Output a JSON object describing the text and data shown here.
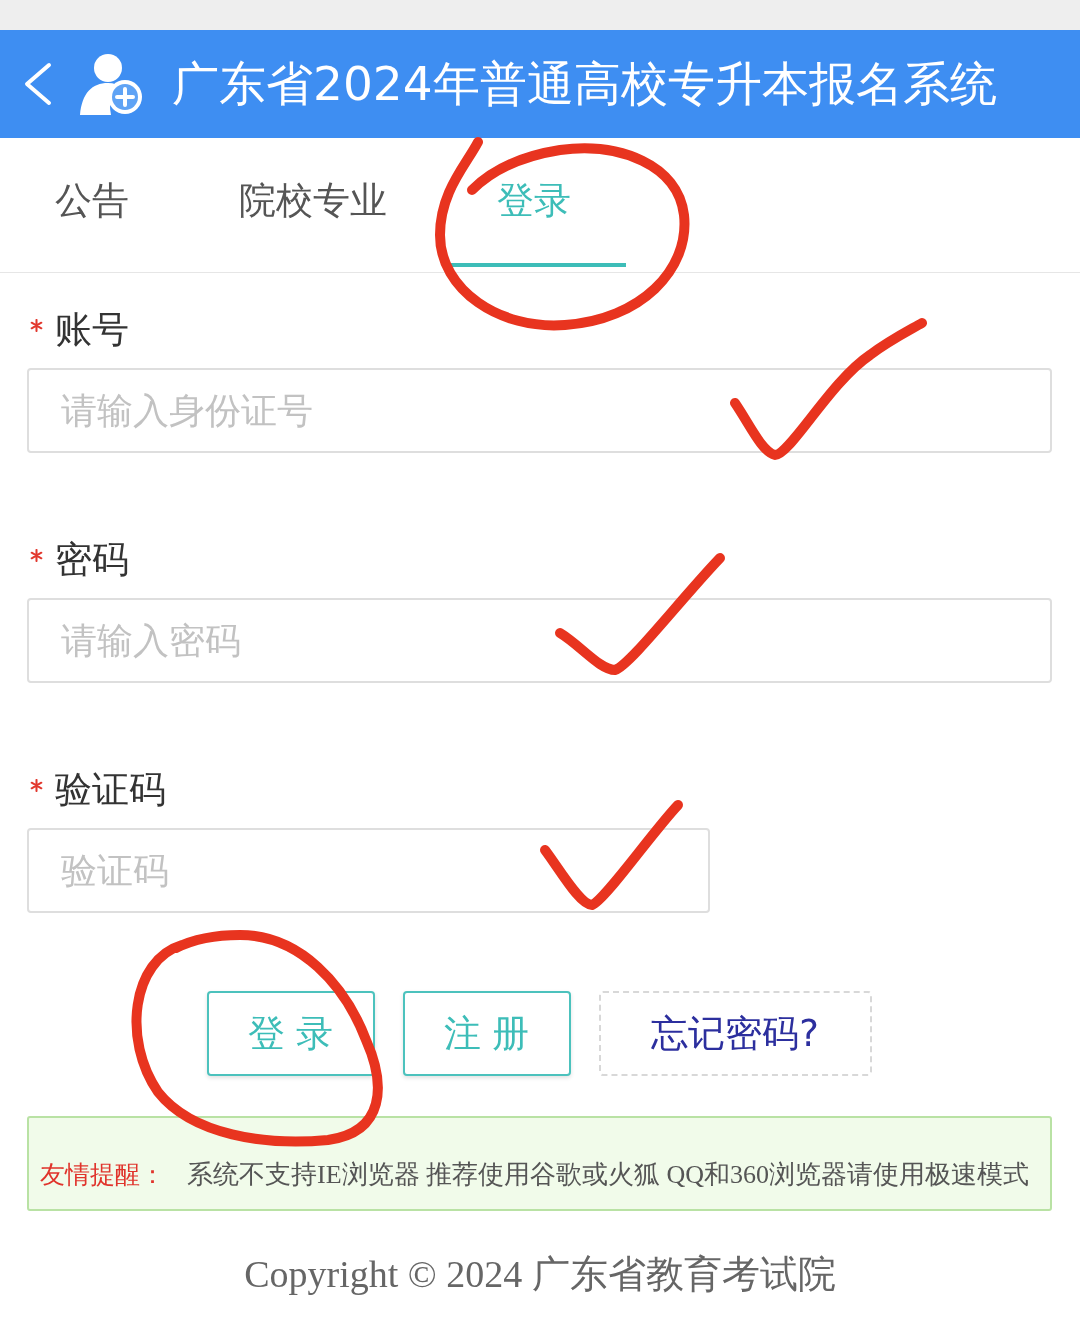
{
  "header": {
    "title": "广东省2024年普通高校专升本报名系统"
  },
  "tabs": [
    {
      "label": "公告",
      "selected": false
    },
    {
      "label": "院校专业",
      "selected": false
    },
    {
      "label": "登录",
      "selected": true
    }
  ],
  "form": {
    "fields": [
      {
        "kind": "text",
        "label": "账号",
        "required": true,
        "placeholder": "请输入身份证号"
      },
      {
        "kind": "password",
        "label": "密码",
        "required": true,
        "placeholder": "请输入密码"
      },
      {
        "kind": "captcha",
        "label": "验证码",
        "required": true,
        "placeholder": "验证码"
      }
    ],
    "buttons": [
      {
        "kind": "button",
        "label": "登 录"
      },
      {
        "kind": "button",
        "label": "注 册"
      },
      {
        "kind": "link",
        "label": "忘记密码?"
      }
    ]
  },
  "notice": {
    "label": "友情提醒：",
    "text": "系统不支持IE浏览器 推荐使用谷歌或火狐 QQ和360浏览器请使用极速模式"
  },
  "footer": {
    "copyright": "Copyright © 2024 广东省教育考试院"
  }
}
